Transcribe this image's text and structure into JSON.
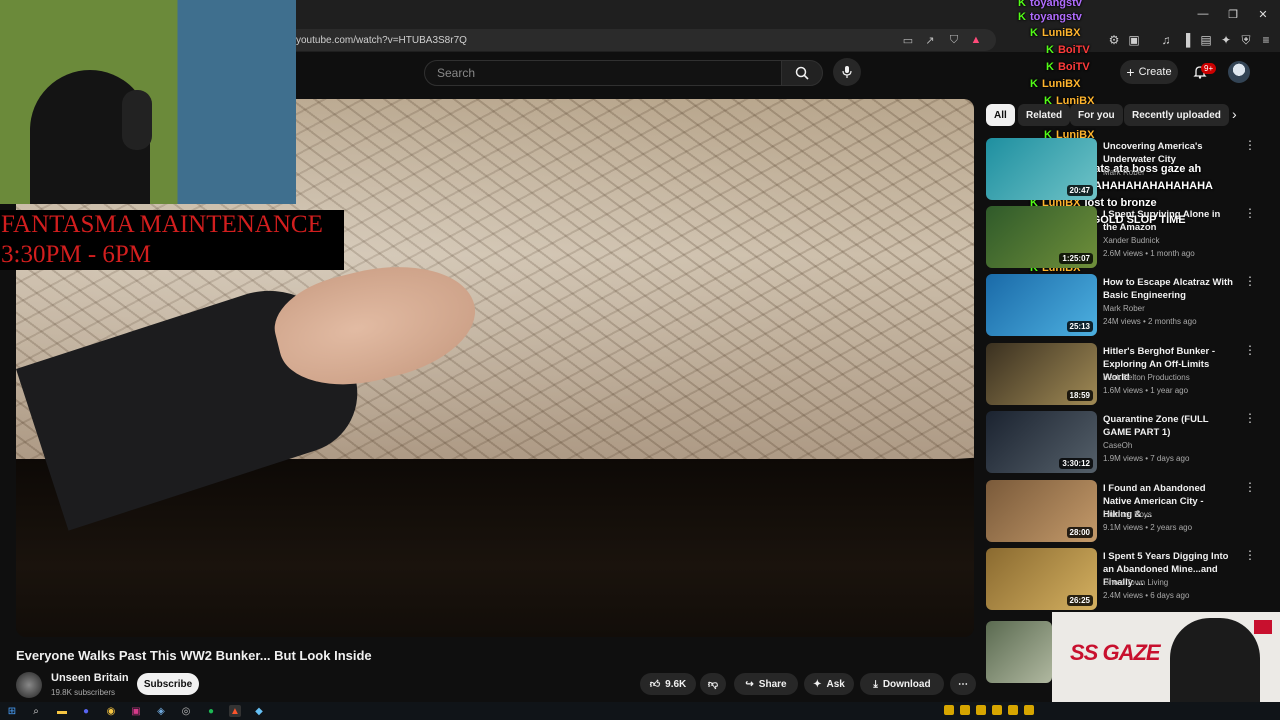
{
  "browser": {
    "url": "youtube.com/watch?v=HTUBA3S8r7Q",
    "window_controls": [
      "—",
      "❐",
      "✕"
    ]
  },
  "header": {
    "search_placeholder": "Search",
    "create_label": "Create",
    "notif_count": "9+"
  },
  "overlay": {
    "banner_line1": "FANTASMA MAINTENANCE",
    "banner_line2": "3:30PM - 6PM",
    "chat": [
      {
        "user": "toyangstv",
        "color": "#b16dff",
        "msg": ""
      },
      {
        "user": "toyangstv",
        "color": "#b16dff",
        "msg": ""
      },
      {
        "user": "LuniBX",
        "color": "#ffb52e",
        "msg": ""
      },
      {
        "user": "BoiTV",
        "color": "#ff3b3b",
        "msg": ""
      },
      {
        "user": "BoiTV",
        "color": "#ff3b3b",
        "msg": ""
      },
      {
        "user": "LuniBX",
        "color": "#ffb52e",
        "msg": ""
      },
      {
        "user": "LuniBX",
        "color": "#ffb52e",
        "msg": ""
      },
      {
        "user": "LuniBX",
        "color": "#ffb52e",
        "msg": ""
      },
      {
        "user": "LuniBX",
        "color": "#ffb52e",
        "msg": ""
      },
      {
        "user": "LuniBX",
        "color": "#ffb52e",
        "msg": ""
      },
      {
        "user": "LuniBX",
        "color": "#ffb52e",
        "msg": "olats ata boss gaze ah"
      },
      {
        "user": "",
        "color": "#ffffff",
        "msg": "HAHAHAHAHAHAHAHAHA"
      },
      {
        "user": "LuniBX",
        "color": "#ffb52e",
        "msg": "lost to bronze"
      },
      {
        "user": "BoiTV",
        "color": "#ff3b3b",
        "msg": "GOLD SLOP TIME"
      },
      {
        "user": "BoiTV",
        "color": "#ff3b3b",
        "msg": ""
      },
      {
        "user": "BoiTV",
        "color": "#ff3b3b",
        "msg": ""
      },
      {
        "user": "LuniBX",
        "color": "#ffb52e",
        "msg": ""
      }
    ],
    "promo_text": "SS GAZE"
  },
  "video": {
    "title": "Everyone Walks Past This WW2 Bunker... But Look Inside",
    "channel": "Unseen Britain",
    "subscribers": "19.8K subscribers",
    "subscribe_label": "Subscribe",
    "likes": "9.6K",
    "share_label": "Share",
    "ask_label": "Ask",
    "download_label": "Download"
  },
  "chips": [
    "All",
    "Related",
    "For you",
    "Recently uploaded"
  ],
  "recommendations": [
    {
      "title": "Uncovering America's Underwater City",
      "channel": "Mark Rober",
      "meta": "",
      "duration": "20:47",
      "thumb": [
        "#1e8fa0",
        "#6fc3c7"
      ]
    },
    {
      "title": "I Spent Surviving Alone in the Amazon",
      "channel": "Xander Budnick",
      "meta": "2.6M views • 1 month ago",
      "duration": "1:25:07",
      "thumb": [
        "#2f5a2a",
        "#6f8f3a"
      ]
    },
    {
      "title": "How to Escape Alcatraz With Basic Engineering",
      "channel": "Mark Rober",
      "meta": "24M views • 2 months ago",
      "duration": "25:13",
      "thumb": [
        "#1a6aa8",
        "#4db0e0"
      ]
    },
    {
      "title": "Hitler's Berghof Bunker - Exploring An Off-Limits World",
      "channel": "Mark Felton Productions",
      "meta": "1.6M views • 1 year ago",
      "duration": "18:59",
      "thumb": [
        "#3a3020",
        "#a08a55"
      ]
    },
    {
      "title": "Quarantine Zone (FULL GAME PART 1)",
      "channel": "CaseOh",
      "meta": "1.9M views • 7 days ago",
      "duration": "3:30:12",
      "thumb": [
        "#1b2330",
        "#55606a"
      ]
    },
    {
      "title": "I Found an Abandoned Native American City - Hiking & ...",
      "channel": "Outdoor Boys",
      "meta": "9.1M views • 2 years ago",
      "duration": "28:00",
      "thumb": [
        "#7a5a3a",
        "#c49a6a"
      ]
    },
    {
      "title": "I Spent 5 Years Digging Into an Abandoned Mine...and Finally ...",
      "channel": "Ghost Town Living",
      "meta": "2.4M views • 6 days ago",
      "duration": "26:25",
      "thumb": [
        "#8a6a30",
        "#d4b060"
      ]
    },
    {
      "title": "",
      "channel": "",
      "meta": "",
      "duration": "",
      "thumb": [
        "#5a6a50",
        "#b0b8a0"
      ]
    }
  ],
  "colors": {
    "accent": "#cc0000",
    "kick_green": "#53fc18",
    "banner_red": "#d21e1e"
  }
}
